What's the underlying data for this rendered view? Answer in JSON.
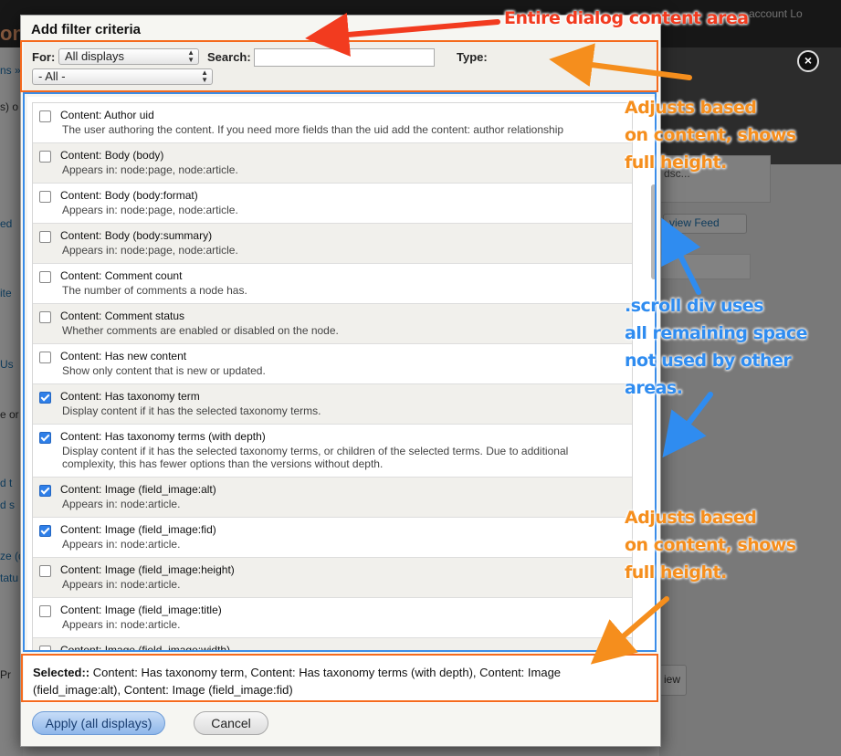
{
  "background": {
    "top_links": "account   Lo",
    "bg_texts": [
      "ont",
      "ns »",
      "s) o",
      "ed",
      "ite",
      "Us",
      "e or",
      "d t",
      "d s",
      "ze (d",
      "tatu",
      "Pr",
      "view Feed",
      "dsc...",
      "iew"
    ]
  },
  "dialog": {
    "title": "Add filter criteria",
    "controls": {
      "for_label": "For:",
      "for_value": "All displays",
      "search_label": "Search:",
      "search_value": "",
      "type_label": "Type:",
      "type_value": "- All -"
    },
    "items": [
      {
        "title": "Content: Author uid",
        "desc": "The user authoring the content. If you need more fields than the uid add the content: author relationship",
        "checked": false
      },
      {
        "title": "Content: Body (body)",
        "desc": "Appears in: node:page, node:article.",
        "checked": false
      },
      {
        "title": "Content: Body (body:format)",
        "desc": "Appears in: node:page, node:article.",
        "checked": false
      },
      {
        "title": "Content: Body (body:summary)",
        "desc": "Appears in: node:page, node:article.",
        "checked": false
      },
      {
        "title": "Content: Comment count",
        "desc": "The number of comments a node has.",
        "checked": false
      },
      {
        "title": "Content: Comment status",
        "desc": "Whether comments are enabled or disabled on the node.",
        "checked": false
      },
      {
        "title": "Content: Has new content",
        "desc": "Show only content that is new or updated.",
        "checked": false
      },
      {
        "title": "Content: Has taxonomy term",
        "desc": "Display content if it has the selected taxonomy terms.",
        "checked": true
      },
      {
        "title": "Content: Has taxonomy terms (with depth)",
        "desc": "Display content if it has the selected taxonomy terms, or children of the selected terms. Due to additional complexity, this has fewer options than the versions without depth.",
        "checked": true
      },
      {
        "title": "Content: Image (field_image:alt)",
        "desc": "Appears in: node:article.",
        "checked": true
      },
      {
        "title": "Content: Image (field_image:fid)",
        "desc": "Appears in: node:article.",
        "checked": true
      },
      {
        "title": "Content: Image (field_image:height)",
        "desc": "Appears in: node:article.",
        "checked": false
      },
      {
        "title": "Content: Image (field_image:title)",
        "desc": "Appears in: node:article.",
        "checked": false
      },
      {
        "title": "Content: Image (field_image:width)",
        "desc": "",
        "checked": false
      }
    ],
    "selected_label": "Selected::",
    "selected_value": " Content: Has taxonomy term, Content: Has taxonomy terms (with depth), Content: Image (field_image:alt), Content: Image (field_image:fid)",
    "apply_label": "Apply (all displays)",
    "cancel_label": "Cancel"
  },
  "annotations": {
    "entire_dialog": "Entire dialog content area",
    "adjusts_top": [
      "Adjusts based",
      "on content, shows",
      "full height."
    ],
    "scroll_div": [
      ".scroll div uses",
      "all remaining space",
      "not used by other",
      "areas."
    ],
    "adjusts_bottom": [
      "Adjusts based",
      "on content, shows",
      "full height."
    ]
  },
  "colors": {
    "annotation_red": "#f23b1f",
    "annotation_orange": "#f58e1d",
    "annotation_blue": "#2f8cf0",
    "checkbox_checked": "#2f7fe8"
  }
}
